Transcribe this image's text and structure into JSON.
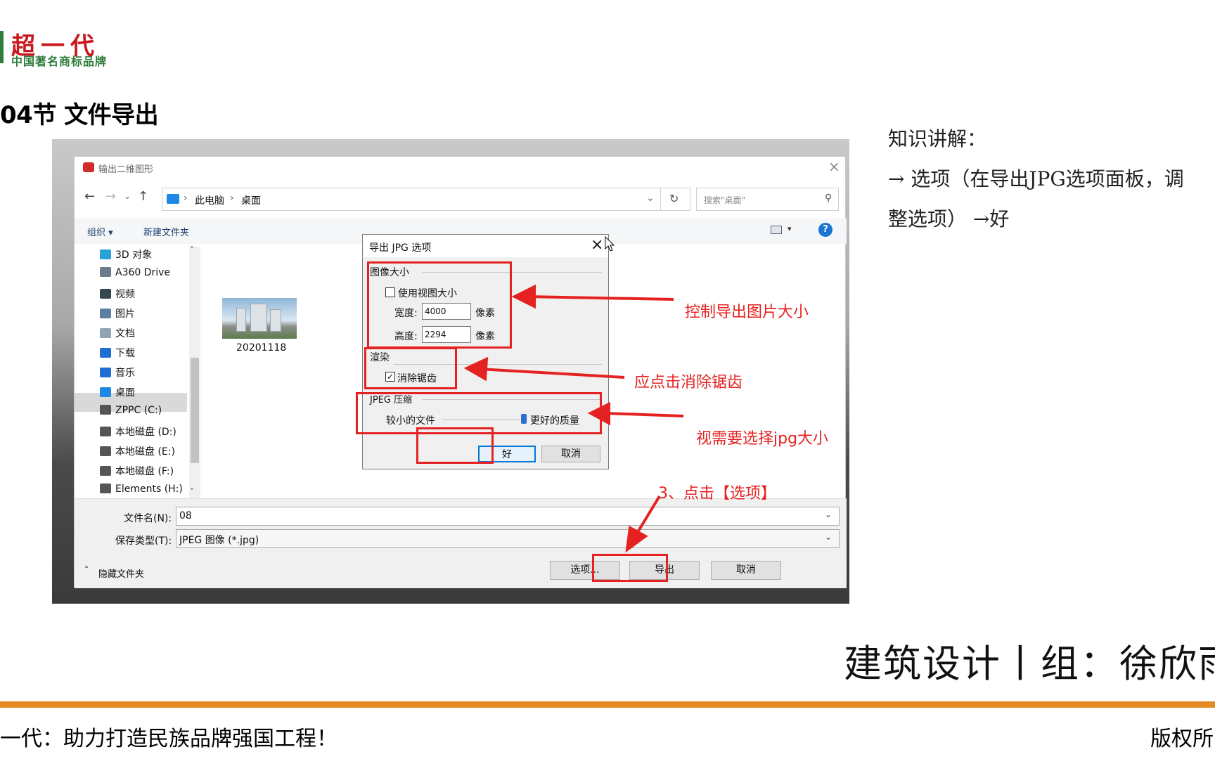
{
  "logo": {
    "main": "超一代",
    "sub": "中国著名商标品牌"
  },
  "section_title": "04节 文件导出",
  "knowledge": {
    "heading": "知识讲解：",
    "line1": "→ 选项（在导出JPG选项面板，调",
    "line2": "整选项） →好"
  },
  "big_title": "建筑设计丨组：徐欣雨",
  "footer": {
    "left": "一代：助力打造民族品牌强国工程！",
    "right": "版权所"
  },
  "colors": {
    "accent": "#e38a25",
    "annotation": "#e52222",
    "logo_red": "#c8171e",
    "logo_green": "#2e7d3b"
  },
  "save_dialog": {
    "title": "输出二维图形",
    "breadcrumb": [
      "此电脑",
      "桌面"
    ],
    "search_placeholder": "搜索\"桌面\"",
    "toolbar": {
      "organize": "组织 ▾",
      "new_folder": "新建文件夹"
    },
    "sidebar": [
      {
        "label": "3D 对象",
        "icon": "cube-icon"
      },
      {
        "label": "A360 Drive",
        "icon": "cloud-icon"
      },
      {
        "label": "视频",
        "icon": "video-icon"
      },
      {
        "label": "图片",
        "icon": "picture-icon"
      },
      {
        "label": "文档",
        "icon": "document-icon"
      },
      {
        "label": "下载",
        "icon": "download-icon"
      },
      {
        "label": "音乐",
        "icon": "music-icon"
      },
      {
        "label": "桌面",
        "icon": "desktop-icon"
      },
      {
        "label": "ZPPC (C:)",
        "icon": "drive-icon"
      },
      {
        "label": "本地磁盘 (D:)",
        "icon": "drive-icon"
      },
      {
        "label": "本地磁盘 (E:)",
        "icon": "drive-icon"
      },
      {
        "label": "本地磁盘 (F:)",
        "icon": "drive-icon"
      },
      {
        "label": "Elements (H:)",
        "icon": "drive-icon"
      }
    ],
    "file_item": "20201118",
    "filename_label": "文件名(N):",
    "filename_value": "08",
    "filetype_label": "保存类型(T):",
    "filetype_value": "JPEG 图像 (*.jpg)",
    "hide_folders": "隐藏文件夹",
    "buttons": {
      "options": "选项...",
      "export": "导出",
      "cancel": "取消"
    }
  },
  "jpg_options": {
    "title": "导出 JPG 选项",
    "image_size": "图像大小",
    "use_view_size": "使用视图大小",
    "width_label": "宽度:",
    "width_value": "4000",
    "height_label": "高度:",
    "height_value": "2294",
    "unit": "像素",
    "render": "渲染",
    "antialias": "消除锯齿",
    "jpeg_compression": "JPEG 压缩",
    "smaller_file": "较小的文件",
    "better_quality": "更好的质量",
    "ok": "好",
    "cancel": "取消"
  },
  "annotations": {
    "size": "控制导出图片大小",
    "antialias": "应点击消除锯齿",
    "quality": "视需要选择jpg大小",
    "step3": "3、点击【选项】"
  }
}
